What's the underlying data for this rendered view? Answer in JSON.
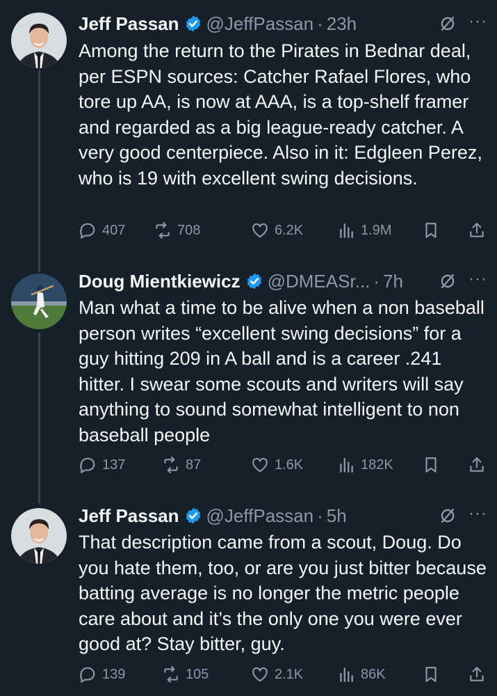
{
  "tweets": [
    {
      "author": {
        "name": "Jeff Passan",
        "handle": "@JeffPassan"
      },
      "time": "23h",
      "text": "Among the return to the Pirates in Bednar deal, per ESPN sources: Catcher Rafael Flores, who tore up AA, is now at AAA, is a top-shelf framer and regarded as a big league-ready catcher. A very good centerpiece. Also in it: Edgleen Perez, who is 19 with excellent swing decisions.",
      "replies": "407",
      "reposts": "708",
      "likes": "6.2K",
      "views": "1.9M"
    },
    {
      "author": {
        "name": "Doug Mientkiewicz",
        "handle": "@DMEASr..."
      },
      "time": "7h",
      "text": "Man what a time to be alive when a non baseball person writes “excellent swing decisions” for a guy hitting 209 in A ball and is a career .241 hitter. I swear some scouts and writers will say anything to sound somewhat intelligent to non baseball people",
      "replies": "137",
      "reposts": "87",
      "likes": "1.6K",
      "views": "182K"
    },
    {
      "author": {
        "name": "Jeff Passan",
        "handle": "@JeffPassan"
      },
      "time": "5h",
      "text": "That description came from a scout, Doug. Do you hate them, too, or are you just bitter because batting average is no longer the metric people care about and it’s the only one you were ever good at? Stay bitter, guy.",
      "replies": "139",
      "reposts": "105",
      "likes": "2.1K",
      "views": "86K"
    }
  ],
  "ui": {
    "separator": "·",
    "more": "···"
  },
  "colors": {
    "background": "#15202b",
    "text": "#f7f9f9",
    "muted": "#8b98a5",
    "verified": "#1d9bf0",
    "thread_line": "#38444d"
  },
  "icons": [
    "verified-badge-icon",
    "grok-icon",
    "more-icon",
    "reply-icon",
    "repost-icon",
    "like-icon",
    "views-icon",
    "bookmark-icon",
    "share-icon"
  ]
}
